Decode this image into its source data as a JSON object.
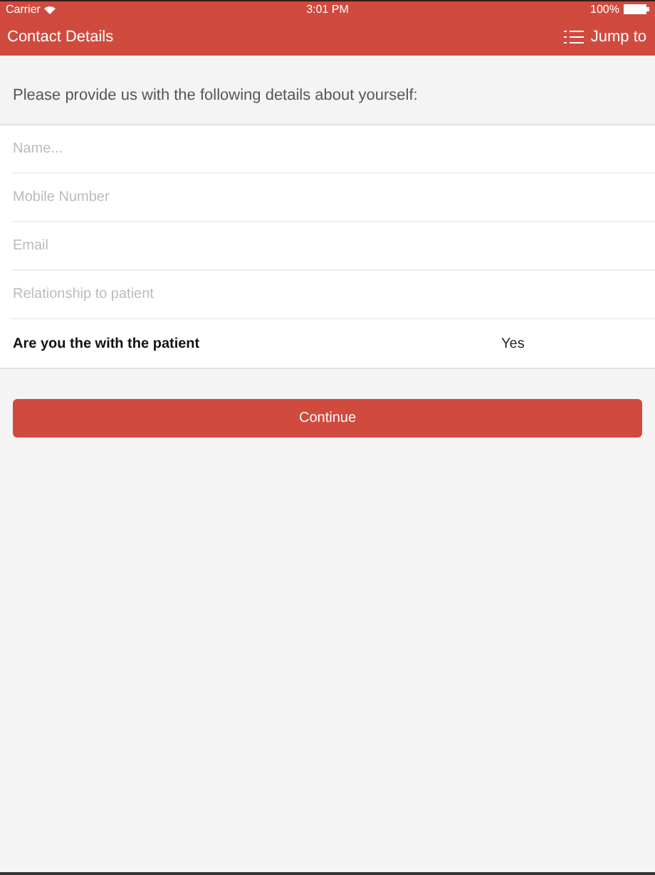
{
  "status_bar": {
    "carrier": "Carrier",
    "time": "3:01 PM",
    "battery": "100%"
  },
  "nav_bar": {
    "title": "Contact Details",
    "action": "Jump to"
  },
  "intro": "Please provide us with the following details about yourself:",
  "fields": [
    {
      "placeholder": "Name..."
    },
    {
      "placeholder": "Mobile Number"
    },
    {
      "placeholder": "Email"
    },
    {
      "placeholder": "Relationship to patient"
    }
  ],
  "question": {
    "label": "Are you the with the patient",
    "value": "Yes"
  },
  "button": "Continue"
}
